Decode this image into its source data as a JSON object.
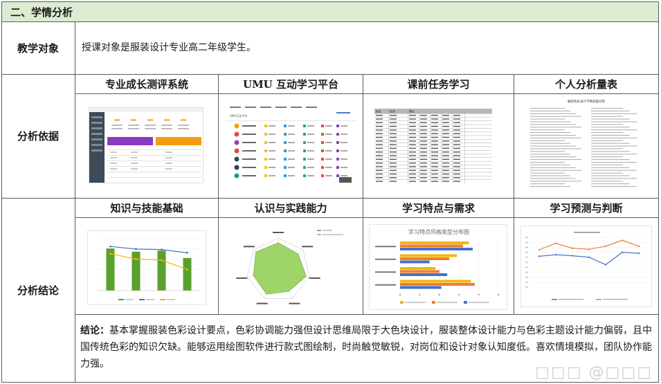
{
  "section_title": "二、学情分析",
  "rows": {
    "object": {
      "label": "教学对象",
      "text": "授课对象是服装设计专业高二年级学生。"
    },
    "basis": {
      "label": "分析依据"
    },
    "result": {
      "label": "分析结论"
    }
  },
  "basis_columns": [
    "专业成长测评系统",
    "UMU 互动学习平台",
    "课前任务学习",
    "个人分析量表"
  ],
  "result_columns": [
    "知识与技能基础",
    "认识与实践能力",
    "学习特点与需求",
    "学习预测与判断"
  ],
  "conclusion": {
    "label": "结论：",
    "text": "基本掌握服装色彩设计要点，色彩协调能力强但设计思维局限于大色块设计，服装整体设计能力与色彩主题设计能力偏弱，且中国传统色彩的知识欠缺。能够运用绘图软件进行款式图绘制，时尚触觉敏锐，对岗位和设计对象认知度低。喜欢情境模拟，团队协作能力强。"
  },
  "watermark": "□□□ @□□□",
  "colors": {
    "header_bg": "#dcebd1",
    "border": "#5a5a5a",
    "bar_green": "#5aa02c",
    "line_blue": "#4472c4",
    "line_yellow": "#f2b705",
    "radar_fill": "#9fd46b",
    "hbar_orange": "#ed7d31"
  },
  "thumbnails": {
    "umu": {
      "tab_text": "UMU互动平台"
    },
    "pretask": {
      "header": [
        "姓名",
        "任务",
        "得分"
      ]
    },
    "scale": {
      "title": "服装色彩设计学情调查问卷"
    }
  },
  "chart_data": [
    {
      "type": "bar",
      "title": "",
      "categories": [
        "",
        "",
        "",
        ""
      ],
      "series": [
        {
          "name": "",
          "values": [
            80,
            74,
            76,
            62
          ]
        },
        {
          "name": "",
          "values": [
            84,
            79,
            78,
            72
          ]
        },
        {
          "name": "",
          "values": [
            70,
            60,
            58,
            40
          ]
        }
      ],
      "ylim": [
        0,
        100
      ],
      "legend": "bottom"
    },
    {
      "type": "radar",
      "axes": [
        "",
        "",
        "",
        "",
        "",
        "",
        ""
      ],
      "values": [
        0.85,
        0.8,
        0.9,
        0.75,
        0.85,
        0.8,
        0.9
      ],
      "legend": "top-right"
    },
    {
      "type": "bar",
      "orientation": "horizontal",
      "title": "学习特点风格类型分布图",
      "categories": [
        "",
        "",
        "",
        ""
      ],
      "series": [
        {
          "name": "",
          "values": [
            3.5,
            2.9,
            1.8,
            3.6
          ]
        },
        {
          "name": "",
          "values": [
            3.2,
            2.5,
            2.0,
            3.8
          ]
        },
        {
          "name": "",
          "values": [
            3.7,
            1.5,
            2.4,
            2.1
          ]
        }
      ],
      "xlim": [
        0,
        5
      ],
      "legend": "bottom"
    },
    {
      "type": "line",
      "title": "",
      "x": [
        1,
        2,
        3,
        4,
        5,
        6,
        7
      ],
      "series": [
        {
          "name": "",
          "values": [
            7.5,
            8.8,
            7.8,
            7.6,
            8.2,
            9.4,
            8.2
          ]
        },
        {
          "name": "",
          "values": [
            6.2,
            6.5,
            6.3,
            6.0,
            4.5,
            7.0,
            6.8
          ]
        }
      ],
      "ylim": [
        0,
        10
      ],
      "legend": "bottom"
    }
  ]
}
